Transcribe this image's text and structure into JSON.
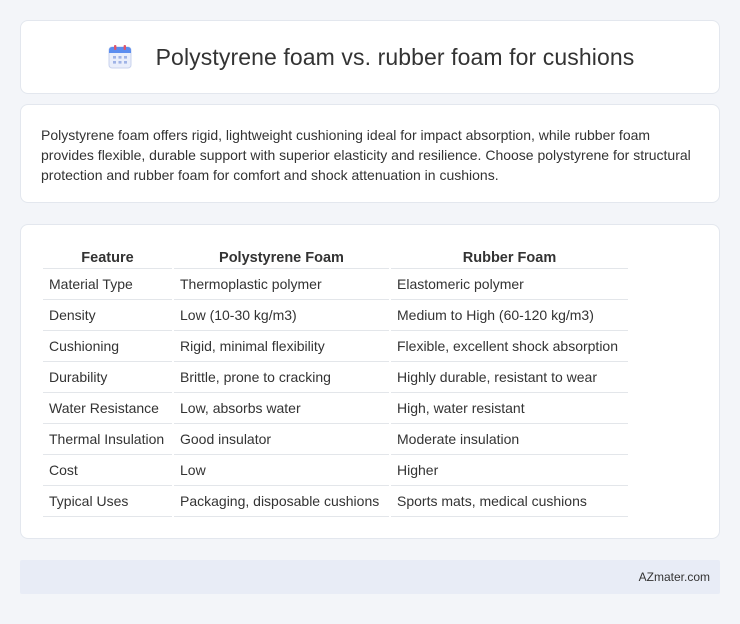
{
  "header": {
    "title": "Polystyrene foam vs. rubber foam for cushions",
    "icon": "calendar-icon"
  },
  "description": "Polystyrene foam offers rigid, lightweight cushioning ideal for impact absorption, while rubber foam provides flexible, durable support with superior elasticity and resilience. Choose polystyrene for structural protection and rubber foam for comfort and shock attenuation in cushions.",
  "table": {
    "headers": [
      "Feature",
      "Polystyrene Foam",
      "Rubber Foam"
    ],
    "rows": [
      [
        "Material Type",
        "Thermoplastic polymer",
        "Elastomeric polymer"
      ],
      [
        "Density",
        "Low (10-30 kg/m3)",
        "Medium to High (60-120 kg/m3)"
      ],
      [
        "Cushioning",
        "Rigid, minimal flexibility",
        "Flexible, excellent shock absorption"
      ],
      [
        "Durability",
        "Brittle, prone to cracking",
        "Highly durable, resistant to wear"
      ],
      [
        "Water Resistance",
        "Low, absorbs water",
        "High, water resistant"
      ],
      [
        "Thermal Insulation",
        "Good insulator",
        "Moderate insulation"
      ],
      [
        "Cost",
        "Low",
        "Higher"
      ],
      [
        "Typical Uses",
        "Packaging, disposable cushions",
        "Sports mats, medical cushions"
      ]
    ]
  },
  "footer": {
    "brand": "AZmater.com"
  }
}
